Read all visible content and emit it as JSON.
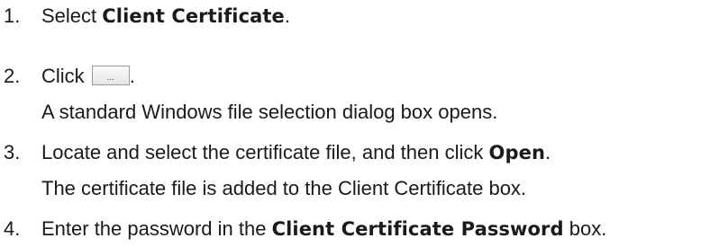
{
  "steps": [
    {
      "number": "1.",
      "text_before": "Select ",
      "bold": "Client Certificate",
      "text_after": "."
    },
    {
      "number": "2.",
      "text_before": "Click ",
      "button_label": "...",
      "text_after": ".",
      "note": "A standard Windows file selection dialog box opens."
    },
    {
      "number": "3.",
      "text_before": "Locate and select the certificate file, and then click ",
      "bold": "Open",
      "text_after": ".",
      "note": "The certificate file is added to the Client Certificate box."
    },
    {
      "number": "4.",
      "text_before": "Enter the password in the ",
      "bold": "Client Certificate Password",
      "text_after": " box."
    }
  ]
}
